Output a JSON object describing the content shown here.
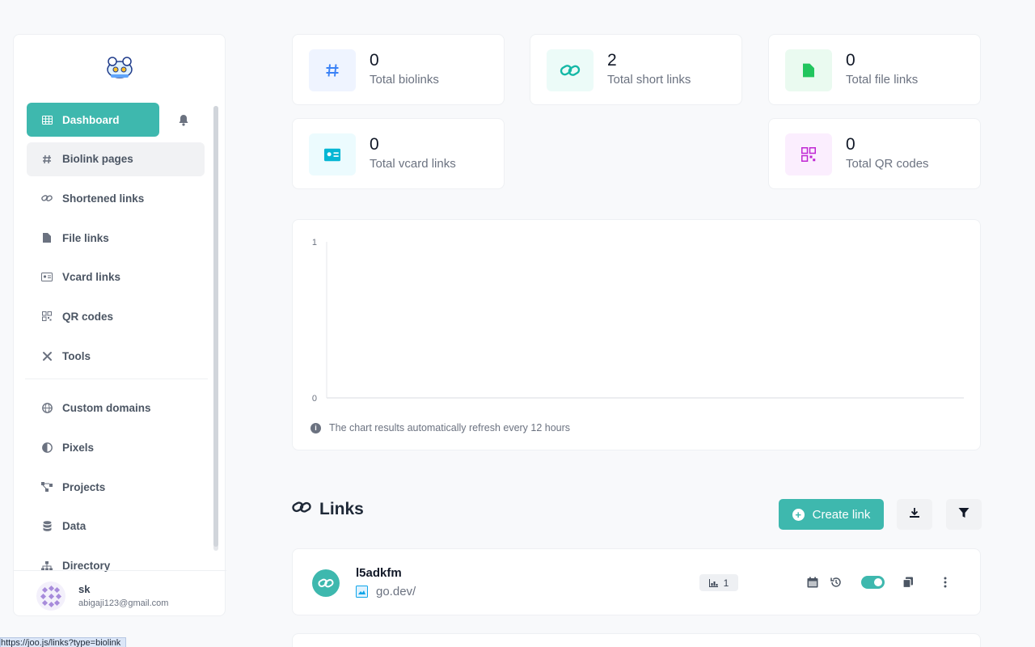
{
  "sidebar": {
    "nav_items": [
      {
        "label": "Dashboard",
        "icon": "table-icon"
      },
      {
        "label": "Biolink pages",
        "icon": "hash-icon"
      },
      {
        "label": "Shortened links",
        "icon": "link-icon"
      },
      {
        "label": "File links",
        "icon": "file-icon"
      },
      {
        "label": "Vcard links",
        "icon": "id-card-icon"
      },
      {
        "label": "QR codes",
        "icon": "qrcode-icon"
      },
      {
        "label": "Tools",
        "icon": "tools-icon"
      },
      {
        "label": "Custom domains",
        "icon": "globe-icon"
      },
      {
        "label": "Pixels",
        "icon": "adjust-icon"
      },
      {
        "label": "Projects",
        "icon": "project-diagram-icon"
      },
      {
        "label": "Data",
        "icon": "database-icon"
      },
      {
        "label": "Directory",
        "icon": "sitemap-icon"
      }
    ],
    "user": {
      "name": "sk",
      "email": "abigaji123@gmail.com"
    }
  },
  "stats": [
    {
      "value": "0",
      "label": "Total biolinks",
      "icon": "hash-icon",
      "color": "#3b82f6",
      "bg": "#eff4ff"
    },
    {
      "value": "2",
      "label": "Total short links",
      "icon": "link-icon",
      "color": "#14b8a6",
      "bg": "#ecfbf8"
    },
    {
      "value": "0",
      "label": "Total file links",
      "icon": "file-icon",
      "color": "#22c55e",
      "bg": "#eafaf0"
    },
    {
      "value": "0",
      "label": "Total vcard links",
      "icon": "id-card-icon",
      "color": "#06b6d4",
      "bg": "#ecfbfe"
    },
    {
      "value": "0",
      "label": "Total QR codes",
      "icon": "qrcode-icon",
      "color": "#c026d3",
      "bg": "#fbeefe"
    }
  ],
  "chart_data": {
    "type": "line",
    "x": [],
    "series": [],
    "ylim": [
      0,
      1
    ],
    "yticks": [
      "1",
      "0"
    ],
    "grid": false,
    "note": "The chart results automatically refresh every 12 hours"
  },
  "links_section": {
    "title": "Links",
    "create_label": "Create link",
    "rows": [
      {
        "name": "l5adkfm",
        "url": "go.dev/",
        "clicks": "1"
      }
    ]
  },
  "status_bar": {
    "url": "https://joo.js/links?type=biolink"
  },
  "colors": {
    "accent": "#3eb8ae"
  }
}
